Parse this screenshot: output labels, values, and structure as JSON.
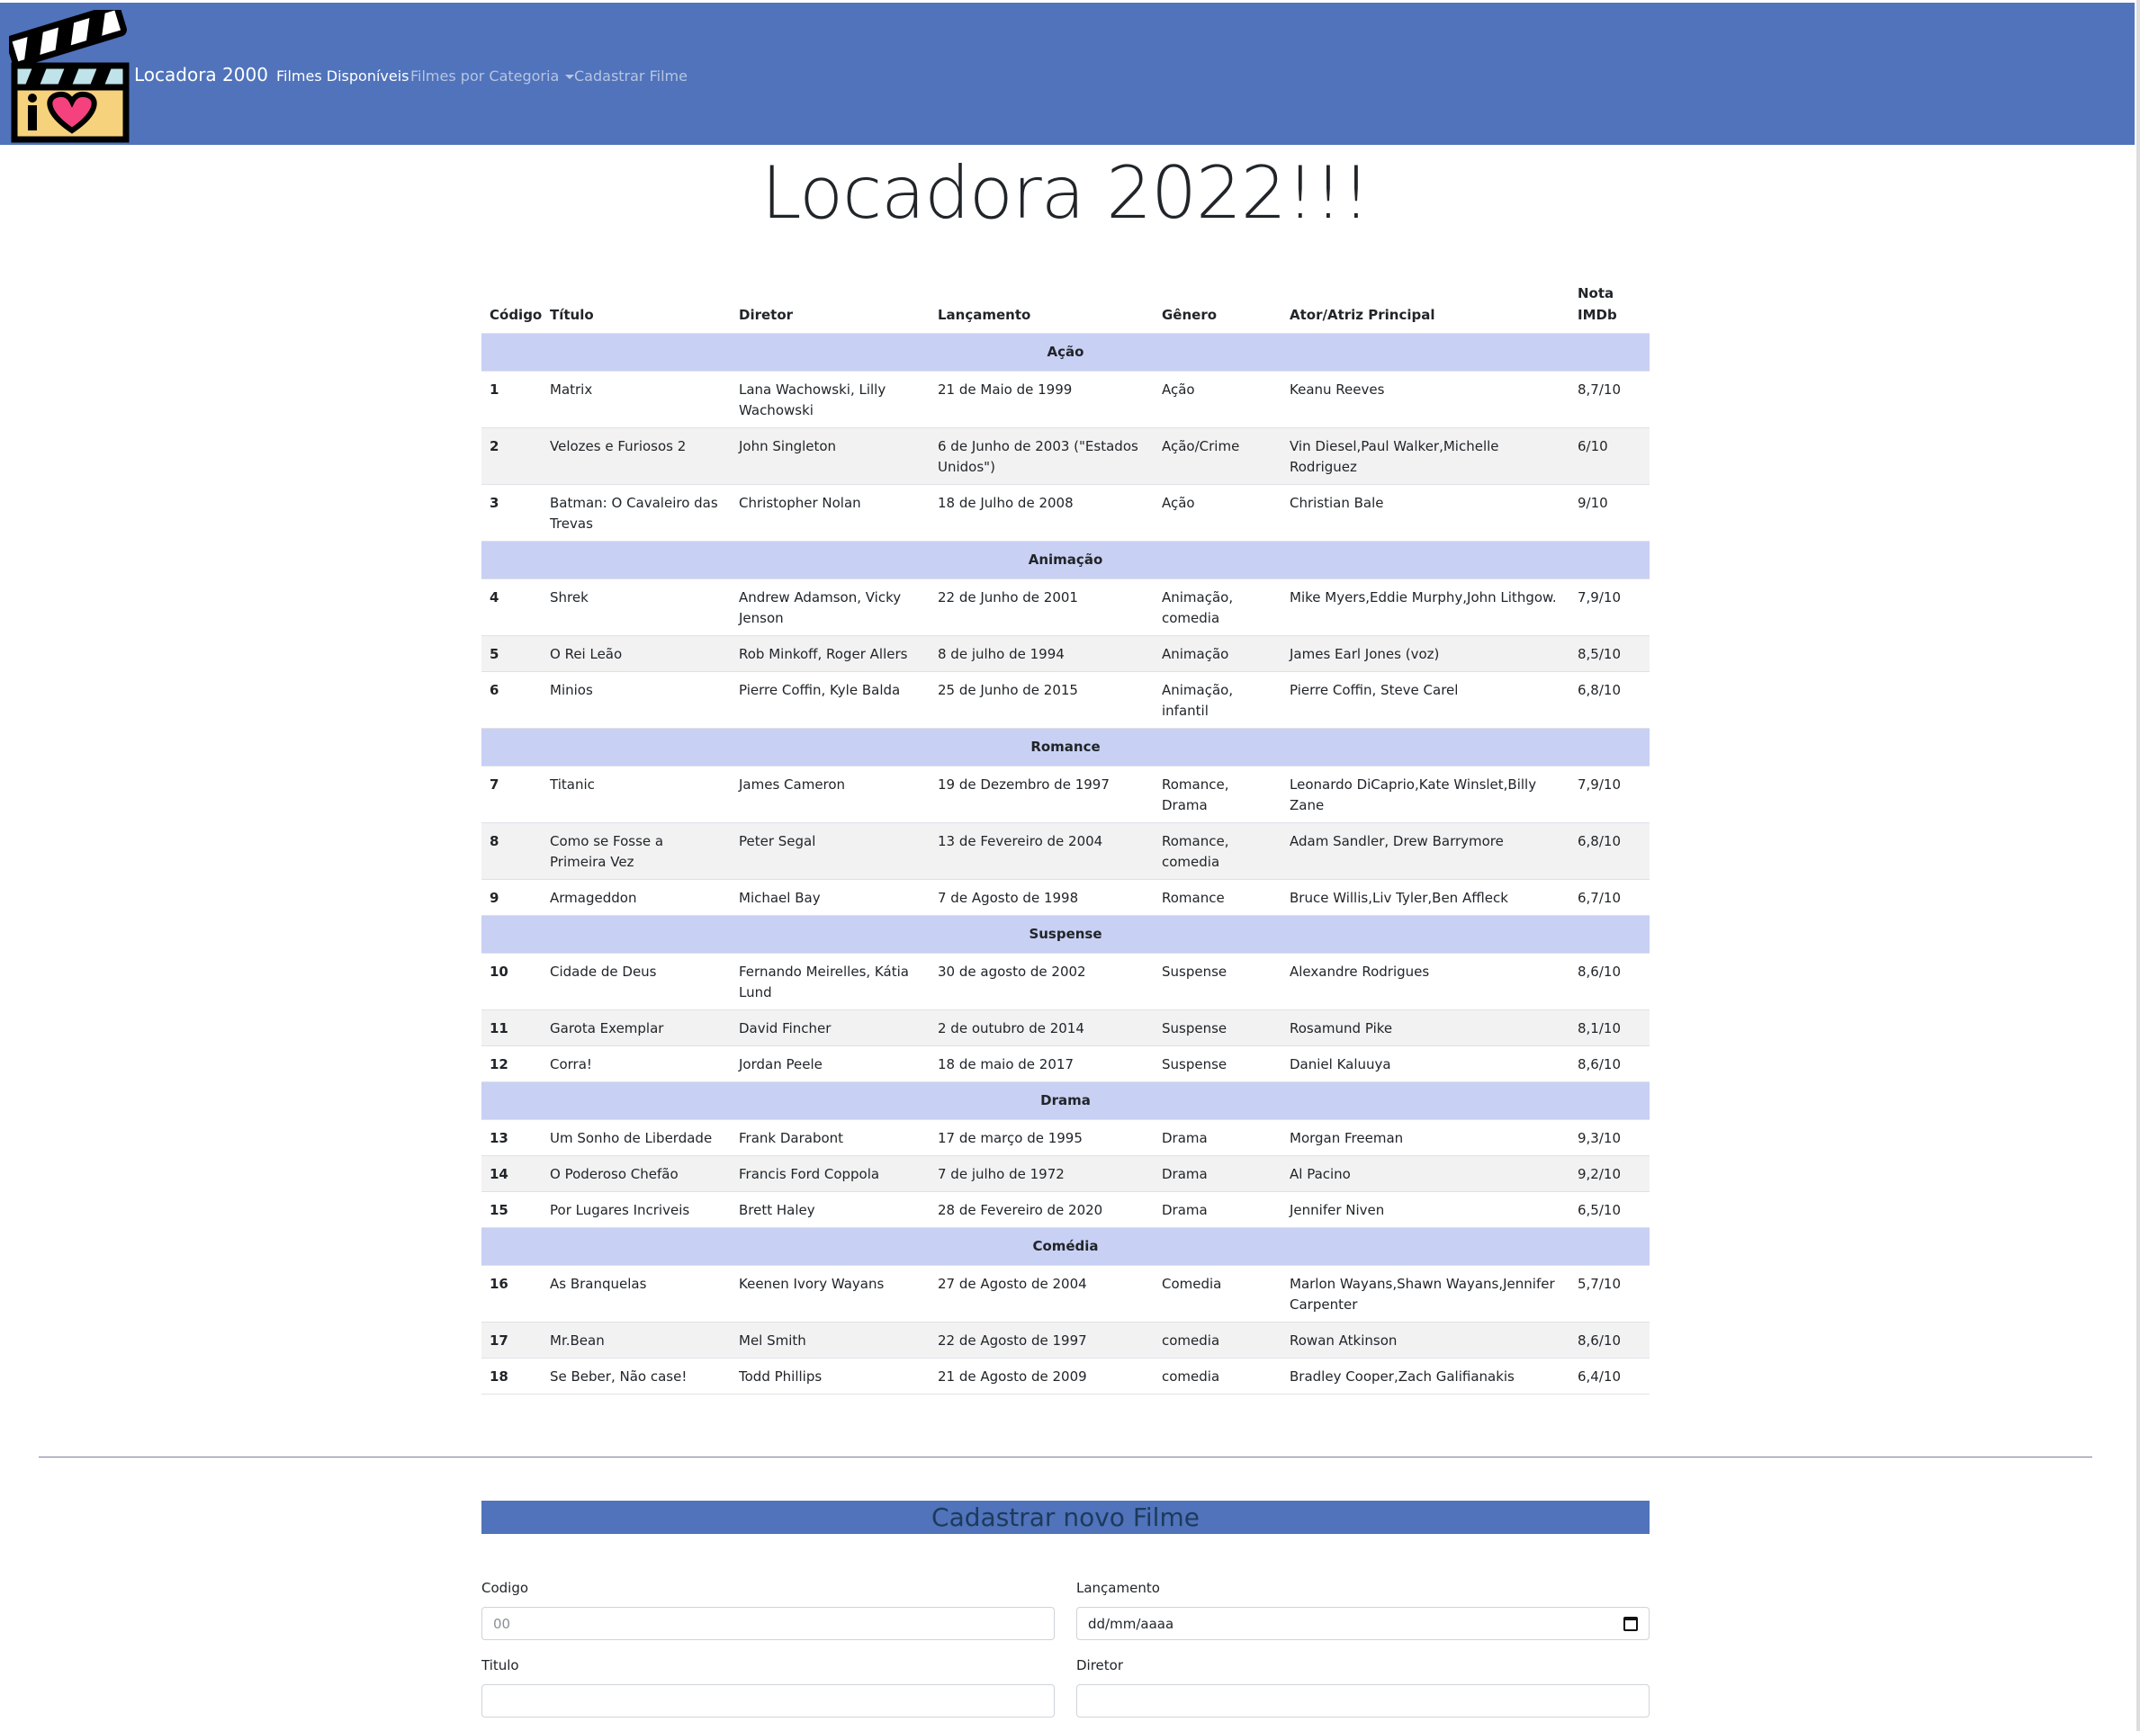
{
  "navbar": {
    "brand": "Locadora 2000",
    "links": [
      {
        "label": "Filmes Disponíveis"
      },
      {
        "label": "Filmes por Categoria"
      },
      {
        "label": "Cadastrar Filme"
      }
    ],
    "logo_icon": "clapperboard-heart-icon",
    "colors": {
      "background": "#5073bb"
    }
  },
  "page_title": "Locadora 2022!!!",
  "table": {
    "headers": {
      "codigo": "Código",
      "titulo": "Título",
      "diretor": "Diretor",
      "lancamento": "Lançamento",
      "genero": "Gênero",
      "ator": "Ator/Atriz Principal",
      "nota": "Nota IMDb"
    },
    "categories": [
      {
        "name": "Ação",
        "rows": [
          {
            "codigo": "1",
            "titulo": "Matrix",
            "diretor": "Lana Wachowski, Lilly Wachowski",
            "lancamento": "21 de Maio de 1999",
            "genero": "Ação",
            "ator": "Keanu Reeves",
            "nota": "8,7/10"
          },
          {
            "codigo": "2",
            "titulo": "Velozes e Furiosos 2",
            "diretor": "John Singleton",
            "lancamento": "6 de Junho de 2003 (\"Estados Unidos\")",
            "genero": "Ação/Crime",
            "ator": "Vin Diesel,Paul Walker,Michelle Rodriguez",
            "nota": "6/10"
          },
          {
            "codigo": "3",
            "titulo": "Batman: O Cavaleiro das Trevas",
            "diretor": "Christopher Nolan",
            "lancamento": "18 de Julho de 2008",
            "genero": "Ação",
            "ator": "Christian Bale",
            "nota": "9/10"
          }
        ]
      },
      {
        "name": "Animação",
        "rows": [
          {
            "codigo": "4",
            "titulo": "Shrek",
            "diretor": "Andrew Adamson, Vicky Jenson",
            "lancamento": "22 de Junho de 2001",
            "genero": "Animação, comedia",
            "ator": "Mike Myers,Eddie Murphy,John Lithgow.",
            "nota": "7,9/10"
          },
          {
            "codigo": "5",
            "titulo": "O Rei Leão",
            "diretor": "Rob Minkoff, Roger Allers",
            "lancamento": "8 de julho de 1994",
            "genero": "Animação",
            "ator": "James Earl Jones (voz)",
            "nota": "8,5/10"
          },
          {
            "codigo": "6",
            "titulo": "Minios",
            "diretor": "Pierre Coffin, Kyle Balda",
            "lancamento": "25 de Junho de 2015",
            "genero": "Animação, infantil",
            "ator": "Pierre Coffin, Steve Carel",
            "nota": "6,8/10"
          }
        ]
      },
      {
        "name": "Romance",
        "rows": [
          {
            "codigo": "7",
            "titulo": "Titanic",
            "diretor": "James Cameron",
            "lancamento": "19 de Dezembro de 1997",
            "genero": "Romance, Drama",
            "ator": "Leonardo DiCaprio,Kate Winslet,Billy Zane",
            "nota": "7,9/10"
          },
          {
            "codigo": "8",
            "titulo": "Como se Fosse a Primeira Vez",
            "diretor": "Peter Segal",
            "lancamento": "13 de Fevereiro de 2004",
            "genero": "Romance, comedia",
            "ator": "Adam Sandler, Drew Barrymore",
            "nota": "6,8/10"
          },
          {
            "codigo": "9",
            "titulo": "Armageddon",
            "diretor": "Michael Bay",
            "lancamento": "7 de Agosto de 1998",
            "genero": "Romance",
            "ator": "Bruce Willis,Liv Tyler,Ben Affleck",
            "nota": "6,7/10"
          }
        ]
      },
      {
        "name": "Suspense",
        "rows": [
          {
            "codigo": "10",
            "titulo": "Cidade de Deus",
            "diretor": "Fernando Meirelles, Kátia Lund",
            "lancamento": "30 de agosto de 2002",
            "genero": "Suspense",
            "ator": "Alexandre Rodrigues",
            "nota": "8,6/10"
          },
          {
            "codigo": "11",
            "titulo": "Garota Exemplar",
            "diretor": "David Fincher",
            "lancamento": "2 de outubro de 2014",
            "genero": "Suspense",
            "ator": "Rosamund Pike",
            "nota": "8,1/10"
          },
          {
            "codigo": "12",
            "titulo": "Corra!",
            "diretor": "Jordan Peele",
            "lancamento": "18 de maio de 2017",
            "genero": "Suspense",
            "ator": "Daniel Kaluuya",
            "nota": "8,6/10"
          }
        ]
      },
      {
        "name": "Drama",
        "rows": [
          {
            "codigo": "13",
            "titulo": "Um Sonho de Liberdade",
            "diretor": "Frank Darabont",
            "lancamento": "17 de março de 1995",
            "genero": "Drama",
            "ator": "Morgan Freeman",
            "nota": "9,3/10"
          },
          {
            "codigo": "14",
            "titulo": "O Poderoso Chefão",
            "diretor": "Francis Ford Coppola",
            "lancamento": "7 de julho de 1972",
            "genero": "Drama",
            "ator": "Al Pacino",
            "nota": "9,2/10"
          },
          {
            "codigo": "15",
            "titulo": "Por Lugares Incriveis",
            "diretor": "Brett Haley",
            "lancamento": "28 de Fevereiro de 2020",
            "genero": "Drama",
            "ator": "Jennifer Niven",
            "nota": "6,5/10"
          }
        ]
      },
      {
        "name": "Comédia",
        "rows": [
          {
            "codigo": "16",
            "titulo": "As Branquelas",
            "diretor": "Keenen Ivory Wayans",
            "lancamento": "27 de Agosto de 2004",
            "genero": "Comedia",
            "ator": "Marlon Wayans,Shawn Wayans,Jennifer Carpenter",
            "nota": "5,7/10"
          },
          {
            "codigo": "17",
            "titulo": "Mr.Bean",
            "diretor": "Mel Smith",
            "lancamento": "22 de Agosto de 1997",
            "genero": "comedia",
            "ator": "Rowan Atkinson",
            "nota": "8,6/10"
          },
          {
            "codigo": "18",
            "titulo": "Se Beber, Não case!",
            "diretor": "Todd Phillips",
            "lancamento": "21 de Agosto de 2009",
            "genero": "comedia",
            "ator": "Bradley Cooper,Zach Galifianakis",
            "nota": "6,4/10"
          }
        ]
      }
    ],
    "colors": {
      "category_row": "#c8d0f3",
      "striped_row": "#f2f2f2"
    }
  },
  "form": {
    "title": "Cadastrar novo Filme",
    "fields": {
      "codigo": {
        "label": "Codigo",
        "placeholder": "00",
        "value": ""
      },
      "lancamento": {
        "label": "Lançamento",
        "value": "dd/mm/aaaa",
        "icon": "calendar-icon"
      },
      "titulo": {
        "label": "Titulo",
        "value": ""
      },
      "diretor": {
        "label": "Diretor",
        "value": ""
      }
    }
  }
}
